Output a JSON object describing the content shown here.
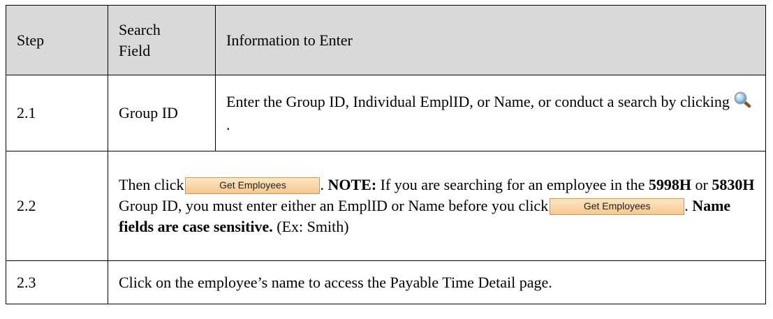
{
  "table": {
    "headers": {
      "step": "Step",
      "search_field_line1": "Search",
      "search_field_line2": "Field",
      "information": "Information to Enter"
    },
    "rows": [
      {
        "step": "2.1",
        "field": "Group ID",
        "text_before": "Enter the Group ID, Individual EmplID, or Name, or conduct a search by clicking",
        "icon": "magnifier-icon",
        "text_after": "."
      },
      {
        "step": "2.2",
        "t1": "Then click",
        "button_label": "Get Employees",
        "t2": ".",
        "note_label": "NOTE:",
        "t3": " If you are searching for an employee in the",
        "group1": "5998H",
        "t4": "or",
        "group2": "5830H",
        "t5": "Group ID, you must enter either an EmplID or Name before you click",
        "button_label_2": "Get Employees",
        "t6": ".",
        "bold_text": "Name fields are case sensitive.",
        "t7": "(Ex: Smith)"
      },
      {
        "step": "2.3",
        "text": "Click on the employee’s name to access the Payable Time Detail page."
      }
    ]
  },
  "colors": {
    "header_bg": "#d9d9d9",
    "button_bg": "#f9d4a3",
    "button_border": "#c99a5b"
  }
}
